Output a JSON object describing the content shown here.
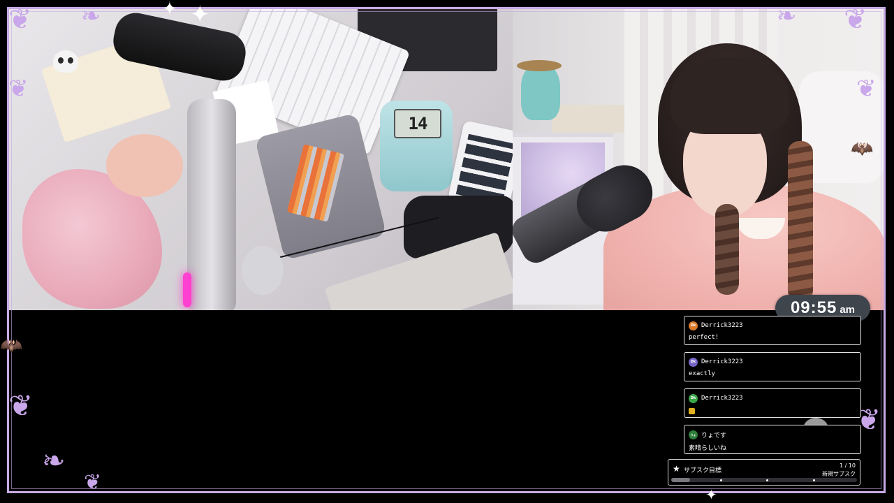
{
  "clock": {
    "time": "09:55",
    "ampm": "am"
  },
  "desk_timer": {
    "display": "14"
  },
  "chat": {
    "messages": [
      {
        "avatar_text": "Dk",
        "avatar_color": "#d9792a",
        "user": "Derrick3223",
        "text": "perfect!"
      },
      {
        "avatar_text": "Dk",
        "avatar_color": "#7a66c9",
        "user": "Derrick3223",
        "text": "exactly"
      },
      {
        "avatar_text": "Dk",
        "avatar_color": "#3aa64a",
        "user": "Derrick3223",
        "text": "",
        "emote": true
      },
      {
        "avatar_text": "りょ",
        "avatar_color": "#2e7d3a",
        "user": "りょです",
        "text": "素晴らしいね"
      }
    ]
  },
  "sub_goal": {
    "title": "サブスク目標",
    "count": "1 / 10",
    "label": "新規サブスク",
    "progress": 0.1
  },
  "colors": {
    "frame": "#c8a9e4",
    "background": "#000000",
    "clock_bg": "#3f454d"
  },
  "icons": {
    "goal": "star-icon",
    "decor": [
      "skull-icon",
      "bat-icon",
      "sparkle-icon"
    ]
  }
}
